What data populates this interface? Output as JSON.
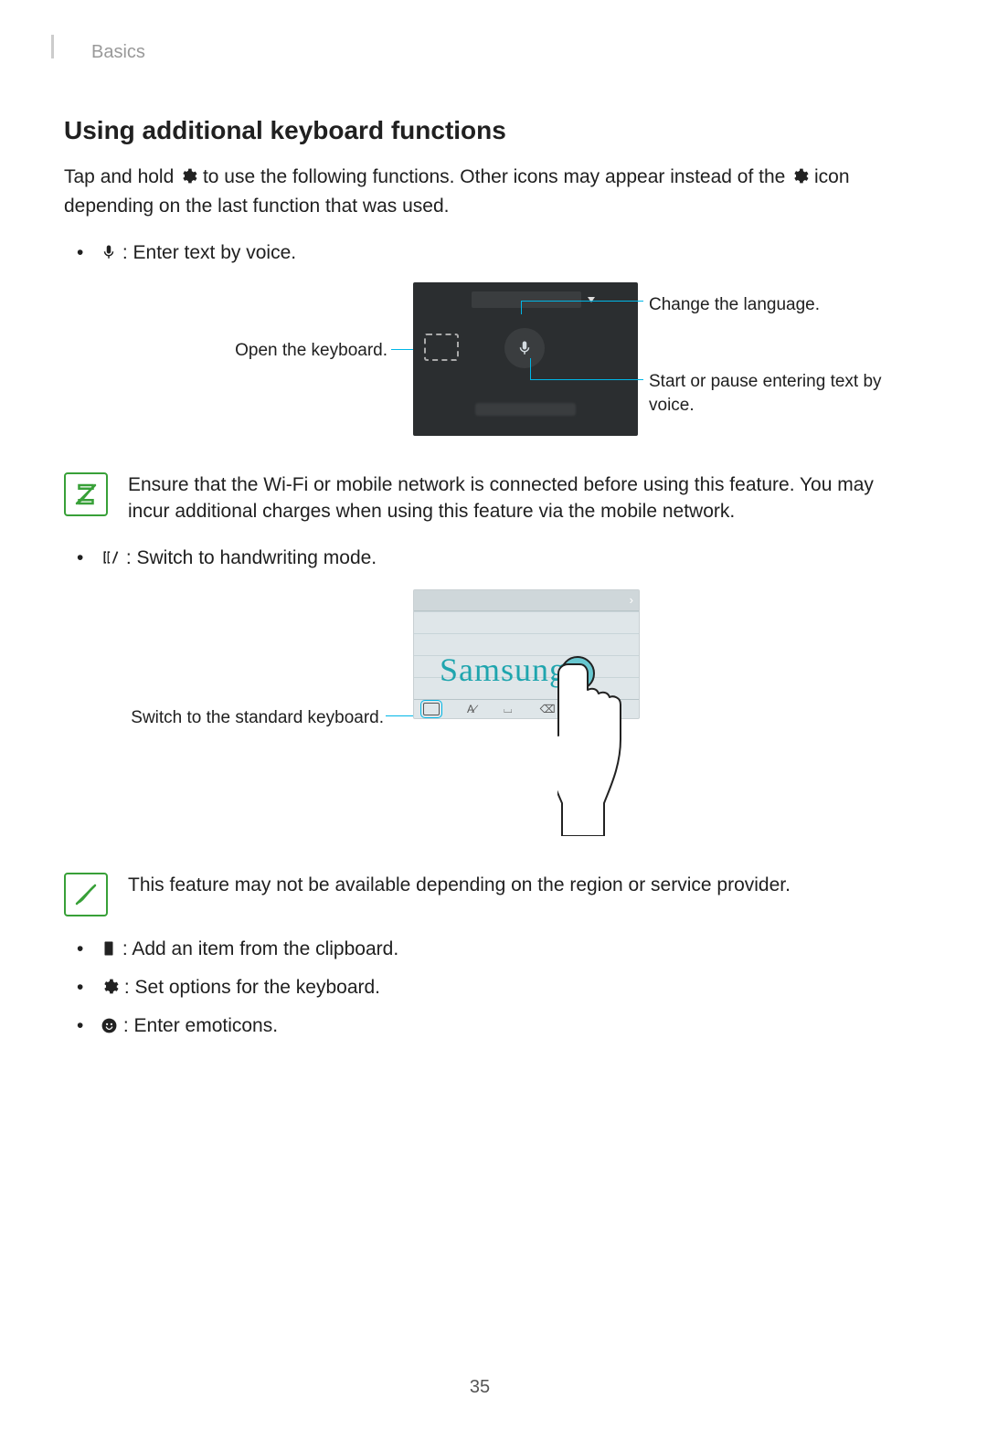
{
  "header": {
    "section": "Basics"
  },
  "title": "Using additional keyboard functions",
  "intro_pre": "Tap and hold ",
  "intro_mid": " to use the following functions. Other icons may appear instead of the ",
  "intro_post": " icon depending on the last function that was used.",
  "bullets_top": {
    "voice": " : Enter text by voice."
  },
  "fig1": {
    "open_keyboard": "Open the keyboard.",
    "change_language": "Change the language.",
    "start_pause": "Start or pause entering text by voice."
  },
  "note1": "Ensure that the Wi-Fi or mobile network is connected before using this feature. You may incur additional charges when using this feature via the mobile network.",
  "bullets_mid": {
    "handwriting": " : Switch to handwriting mode."
  },
  "fig2": {
    "switch_standard": "Switch to the standard keyboard.",
    "handwritten": "Samsung"
  },
  "note2": "This feature may not be available depending on the region or service provider.",
  "bullets_bottom": {
    "clipboard": " : Add an item from the clipboard.",
    "settings": " : Set options for the keyboard.",
    "emoticons": " : Enter emoticons."
  },
  "page_number": "35"
}
